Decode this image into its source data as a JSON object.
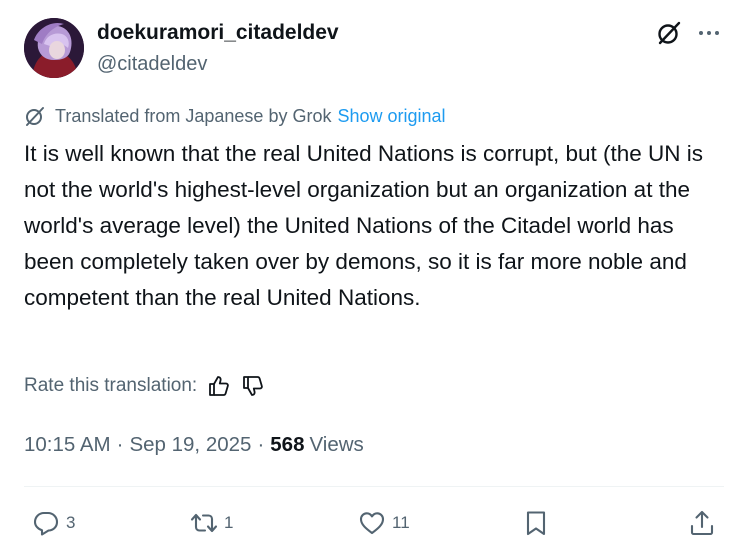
{
  "author": {
    "display_name": "doekuramori_citadeldev",
    "handle": "@citadeldev"
  },
  "header_icons": {
    "grok": "grok-icon",
    "more": "more-horizontal-icon"
  },
  "translation": {
    "notice": "Translated from Japanese by Grok",
    "show_original_label": "Show original",
    "icon": "grok-icon"
  },
  "tweet": {
    "text": "It is well known that the real United Nations is corrupt, but (the UN is not the world's highest-level organization but an organization at the world's average level) the United Nations of the Citadel world has been completely taken over by demons, so it is far more noble and competent than the real United Nations."
  },
  "rate": {
    "label": "Rate this translation:",
    "thumbs_up_icon": "thumbs-up-icon",
    "thumbs_down_icon": "thumbs-down-icon"
  },
  "meta": {
    "time": "10:15 AM",
    "separator": "·",
    "date": "Sep 19, 2025",
    "views_count": "568",
    "views_label": "Views"
  },
  "actions": {
    "replies": "3",
    "reposts": "1",
    "likes": "11"
  },
  "colors": {
    "text_primary": "#0f1419",
    "text_secondary": "#536471",
    "link": "#1d9bf0"
  }
}
